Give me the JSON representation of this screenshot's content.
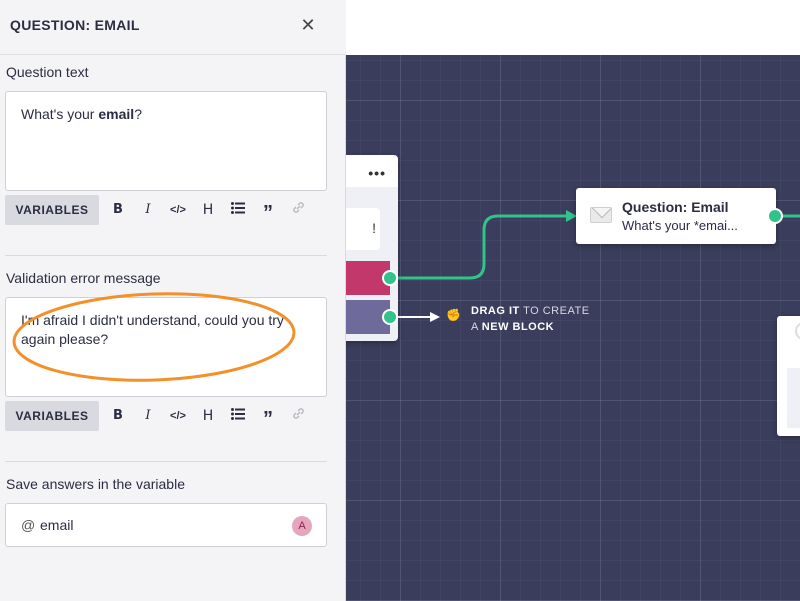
{
  "panel": {
    "title": "QUESTION: EMAIL",
    "close_icon": "close-icon",
    "question_text": {
      "label": "Question text",
      "before": "What's your ",
      "bold": "email",
      "after": "?"
    },
    "validation": {
      "label": "Validation error message",
      "value": "I'm afraid I didn't understand, could you try again please?"
    },
    "toolbar": {
      "variables_label": "VARIABLES",
      "bold": "B",
      "italic": "I",
      "code": "</>",
      "heading": "H",
      "list_icon": "bulleted-list-icon",
      "quote": "”",
      "link_icon": "link-icon"
    },
    "save_answers": {
      "label": "Save answers in the variable",
      "prefix": "@",
      "value": "email",
      "avatar": "A"
    }
  },
  "canvas": {
    "email_block": {
      "icon": "mail-icon",
      "title": "Question: Email",
      "subtitle": "What's your *emai..."
    },
    "left_block": {
      "menu": "•••",
      "bubble_text": "!"
    },
    "drag_hint": {
      "hand_icon": "fist-icon",
      "line1_bold": "DRAG IT",
      "line1_rest": " TO CREATE",
      "line2_prefix": "A ",
      "line2_bold": "NEW BLOCK"
    }
  },
  "colors": {
    "canvas_bg": "#3a3d5c",
    "connector_green": "#32c38a",
    "button_pink": "#c2386a",
    "button_purple": "#6e6a9c",
    "highlight_orange": "#f2902a"
  }
}
